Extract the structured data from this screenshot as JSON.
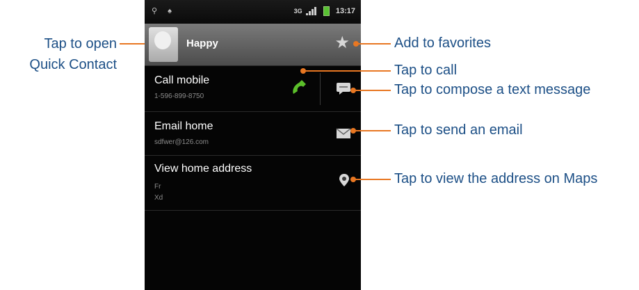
{
  "status_bar": {
    "time": "13:17",
    "network_type": "3G"
  },
  "contact": {
    "name": "Happy",
    "avatar_icon": "contact-photo-icon",
    "favorite_icon": "star-icon"
  },
  "rows": [
    {
      "title": "Call mobile",
      "subtitle": "1-596-899-8750",
      "primary_icon": "phone-icon",
      "secondary_icon": "message-icon"
    },
    {
      "title": "Email home",
      "subtitle": "sdfwer@126.com",
      "secondary_icon": "mail-icon"
    },
    {
      "title": "View home address",
      "subtitle_line1": "Fr",
      "subtitle_line2": "Xd",
      "secondary_icon": "map-pin-icon"
    }
  ],
  "callouts": {
    "quick_contact_line1": "Tap to open",
    "quick_contact_line2": "Quick Contact",
    "favorites": "Add to favorites",
    "call": "Tap to call",
    "compose": "Tap to compose a text message",
    "email": "Tap to send an email",
    "maps": "Tap to view the address on Maps"
  },
  "colors": {
    "callout_text": "#1c4f86",
    "leader_line": "#e87722",
    "call_icon": "#5bbf2a"
  }
}
